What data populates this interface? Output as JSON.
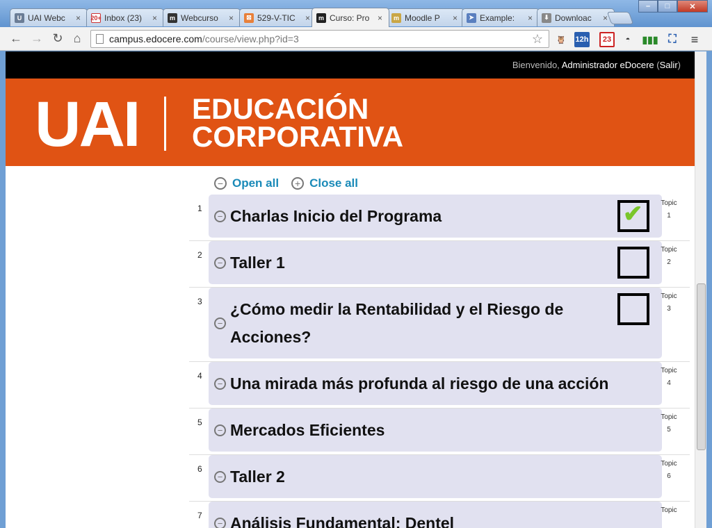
{
  "browser": {
    "tabs": [
      {
        "label": "UAI Webc",
        "icon": "uai-favicon",
        "active": false
      },
      {
        "label": "Inbox (23)",
        "icon": "gmail-favicon",
        "badge": "20+",
        "active": false
      },
      {
        "label": "Webcurso",
        "icon": "moodle-favicon",
        "active": false
      },
      {
        "label": "529-V-TIC",
        "icon": "orange-favicon",
        "active": false
      },
      {
        "label": "Curso: Pro",
        "icon": "moodle-favicon",
        "active": true
      },
      {
        "label": "Moodle P",
        "icon": "moodle-plugins-favicon",
        "active": false
      },
      {
        "label": "Example:",
        "icon": "paper-plane-favicon",
        "active": false
      },
      {
        "label": "Downloac",
        "icon": "download-favicon",
        "active": false
      }
    ],
    "tab_close": "×",
    "url_domain": "campus.edocere.com",
    "url_path": "/course/view.php?id=3",
    "extensions": [
      "owl-extension-icon",
      "calendar-12h-icon",
      "gmail-23-icon",
      "spy-icon",
      "signal-icon",
      "screenshot-icon"
    ],
    "ext_labels": {
      "calendar": "12h",
      "gmail": "23"
    }
  },
  "page": {
    "welcome_prefix": "Bienvenido,",
    "user_name": "Administrador eDocere",
    "logout_open": "(",
    "logout": "Salir",
    "logout_close": ")",
    "logo_main": "UAI",
    "logo_line1": "EDUCACIÓN",
    "logo_line2": "CORPORATIVA",
    "open_all": "Open all",
    "close_all": "Close all",
    "topic_label": "Topic",
    "topics": [
      {
        "num": "1",
        "title": "Charlas Inicio del Programa",
        "checkbox": true,
        "checked": true,
        "topic_no": "1"
      },
      {
        "num": "2",
        "title": "Taller 1",
        "checkbox": true,
        "checked": false,
        "topic_no": "2"
      },
      {
        "num": "3",
        "title": "¿Cómo medir la Rentabilidad y el Riesgo de Acciones?",
        "checkbox": true,
        "checked": false,
        "topic_no": "3"
      },
      {
        "num": "4",
        "title": "Una mirada más profunda al riesgo de una acción",
        "checkbox": false,
        "checked": false,
        "topic_no": "4"
      },
      {
        "num": "5",
        "title": "Mercados Eficientes",
        "checkbox": false,
        "checked": false,
        "topic_no": "5"
      },
      {
        "num": "6",
        "title": "Taller 2",
        "checkbox": false,
        "checked": false,
        "topic_no": "6"
      },
      {
        "num": "7",
        "title": "Análisis Fundamental: Dentel",
        "checkbox": false,
        "checked": false,
        "topic_no": ""
      }
    ]
  },
  "colors": {
    "banner": "#e05314",
    "link": "#1a8ab8",
    "panel": "#e1e1f0",
    "check": "#7ac62a"
  }
}
